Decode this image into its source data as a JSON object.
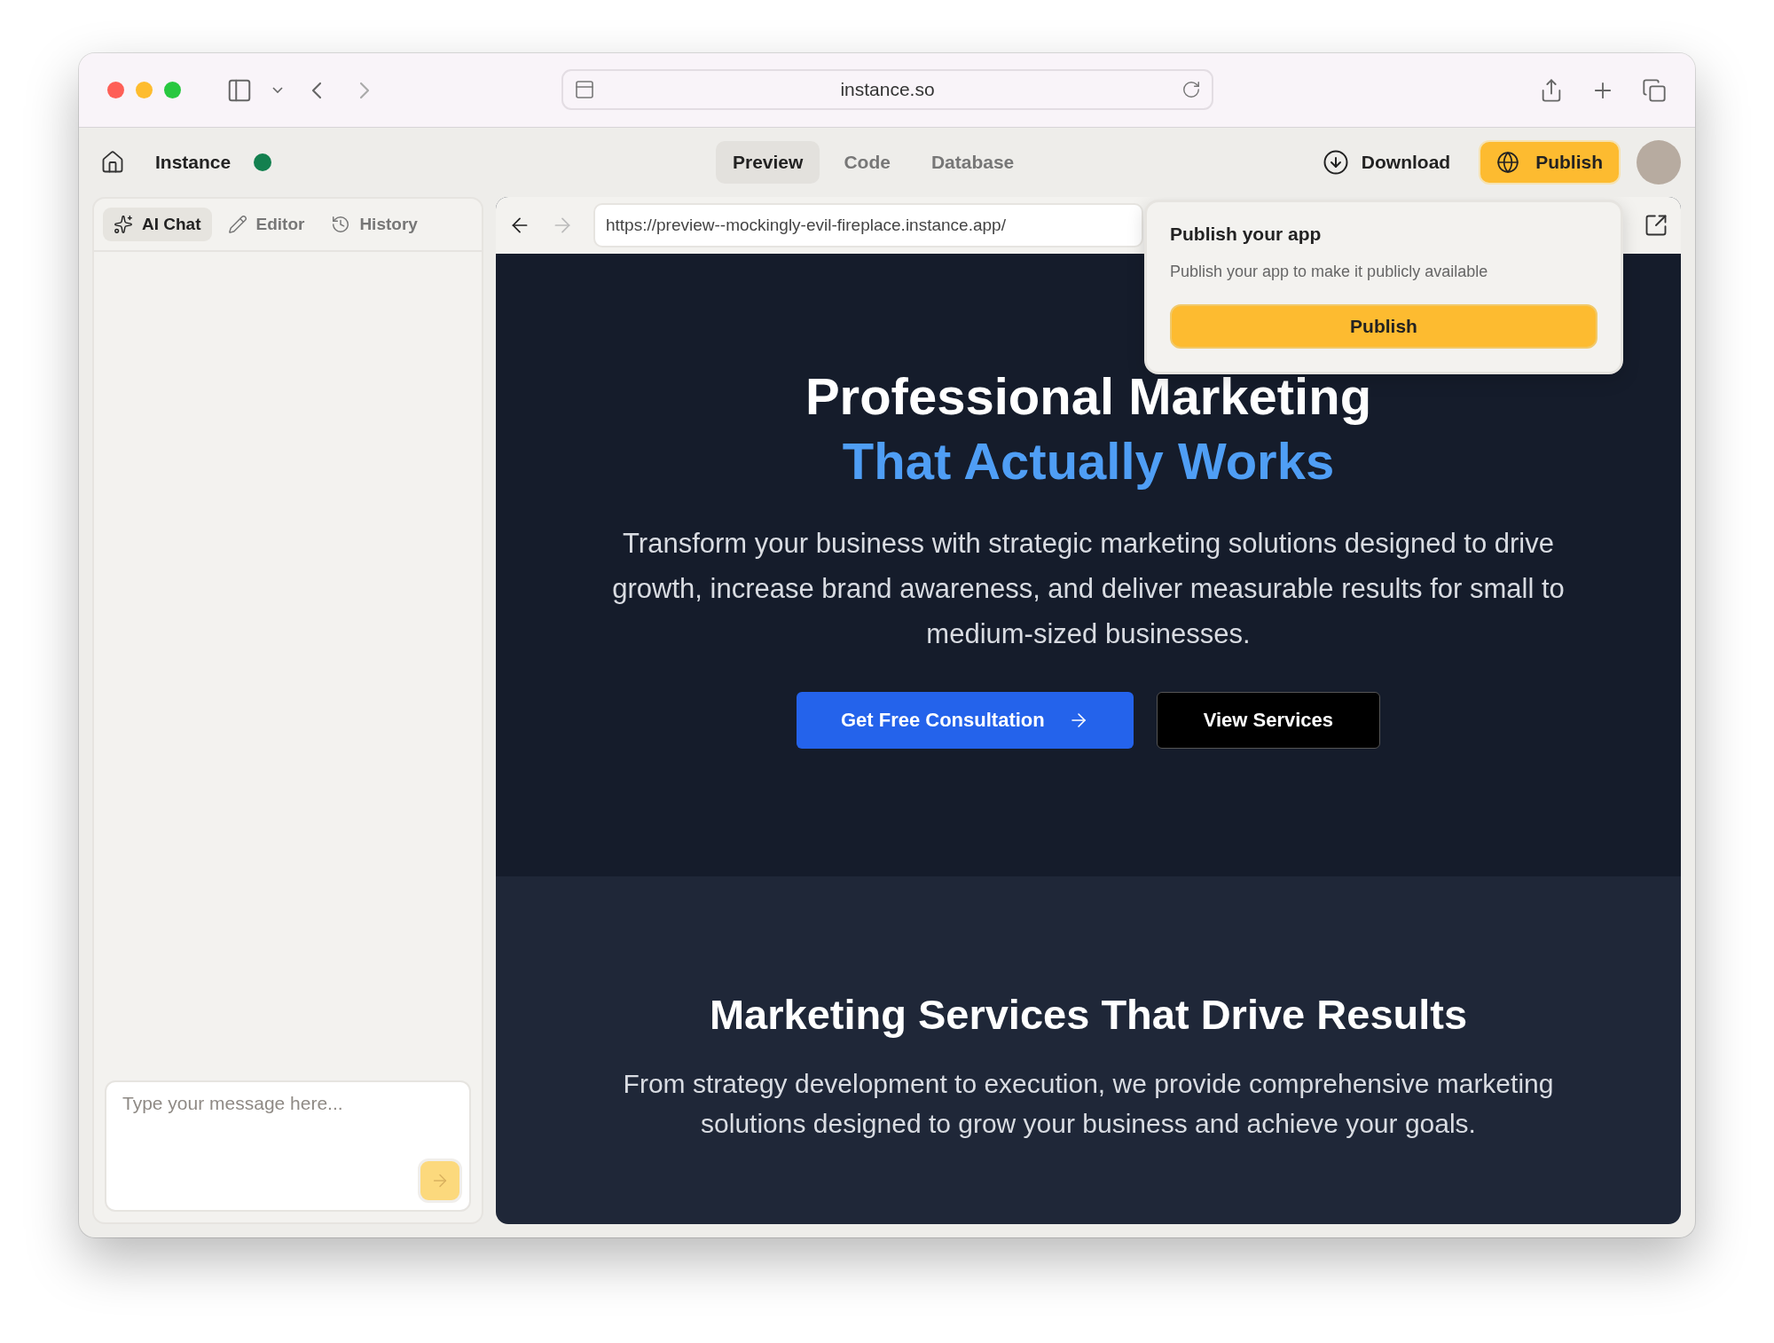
{
  "browser": {
    "address": "instance.so"
  },
  "header": {
    "app_name": "Instance",
    "tabs": [
      {
        "label": "Preview",
        "selected": true
      },
      {
        "label": "Code",
        "selected": false
      },
      {
        "label": "Database",
        "selected": false
      }
    ],
    "download": "Download",
    "publish": "Publish"
  },
  "sidebar": {
    "tabs": [
      {
        "label": "AI Chat",
        "selected": true
      },
      {
        "label": "Editor",
        "selected": false
      },
      {
        "label": "History",
        "selected": false
      }
    ],
    "message": {
      "placeholder": "Type your message here..."
    }
  },
  "preview": {
    "url": "https://preview--mockingly-evil-fireplace.instance.app/",
    "hero": {
      "title": "Professional Marketing",
      "highlight": "That Actually Works",
      "text": "Transform your business with strategic marketing solutions designed to drive growth, increase brand awareness, and deliver measurable results for small to medium-sized businesses.",
      "primary": "Get Free Consultation",
      "secondary": "View Services"
    },
    "services": {
      "title": "Marketing Services That Drive Results",
      "text": "From strategy development to execution, we provide comprehensive marketing solutions designed to grow your business and achieve your goals."
    }
  },
  "popover": {
    "title": "Publish your app",
    "text": "Publish your app to make it publicly available",
    "button": "Publish"
  }
}
